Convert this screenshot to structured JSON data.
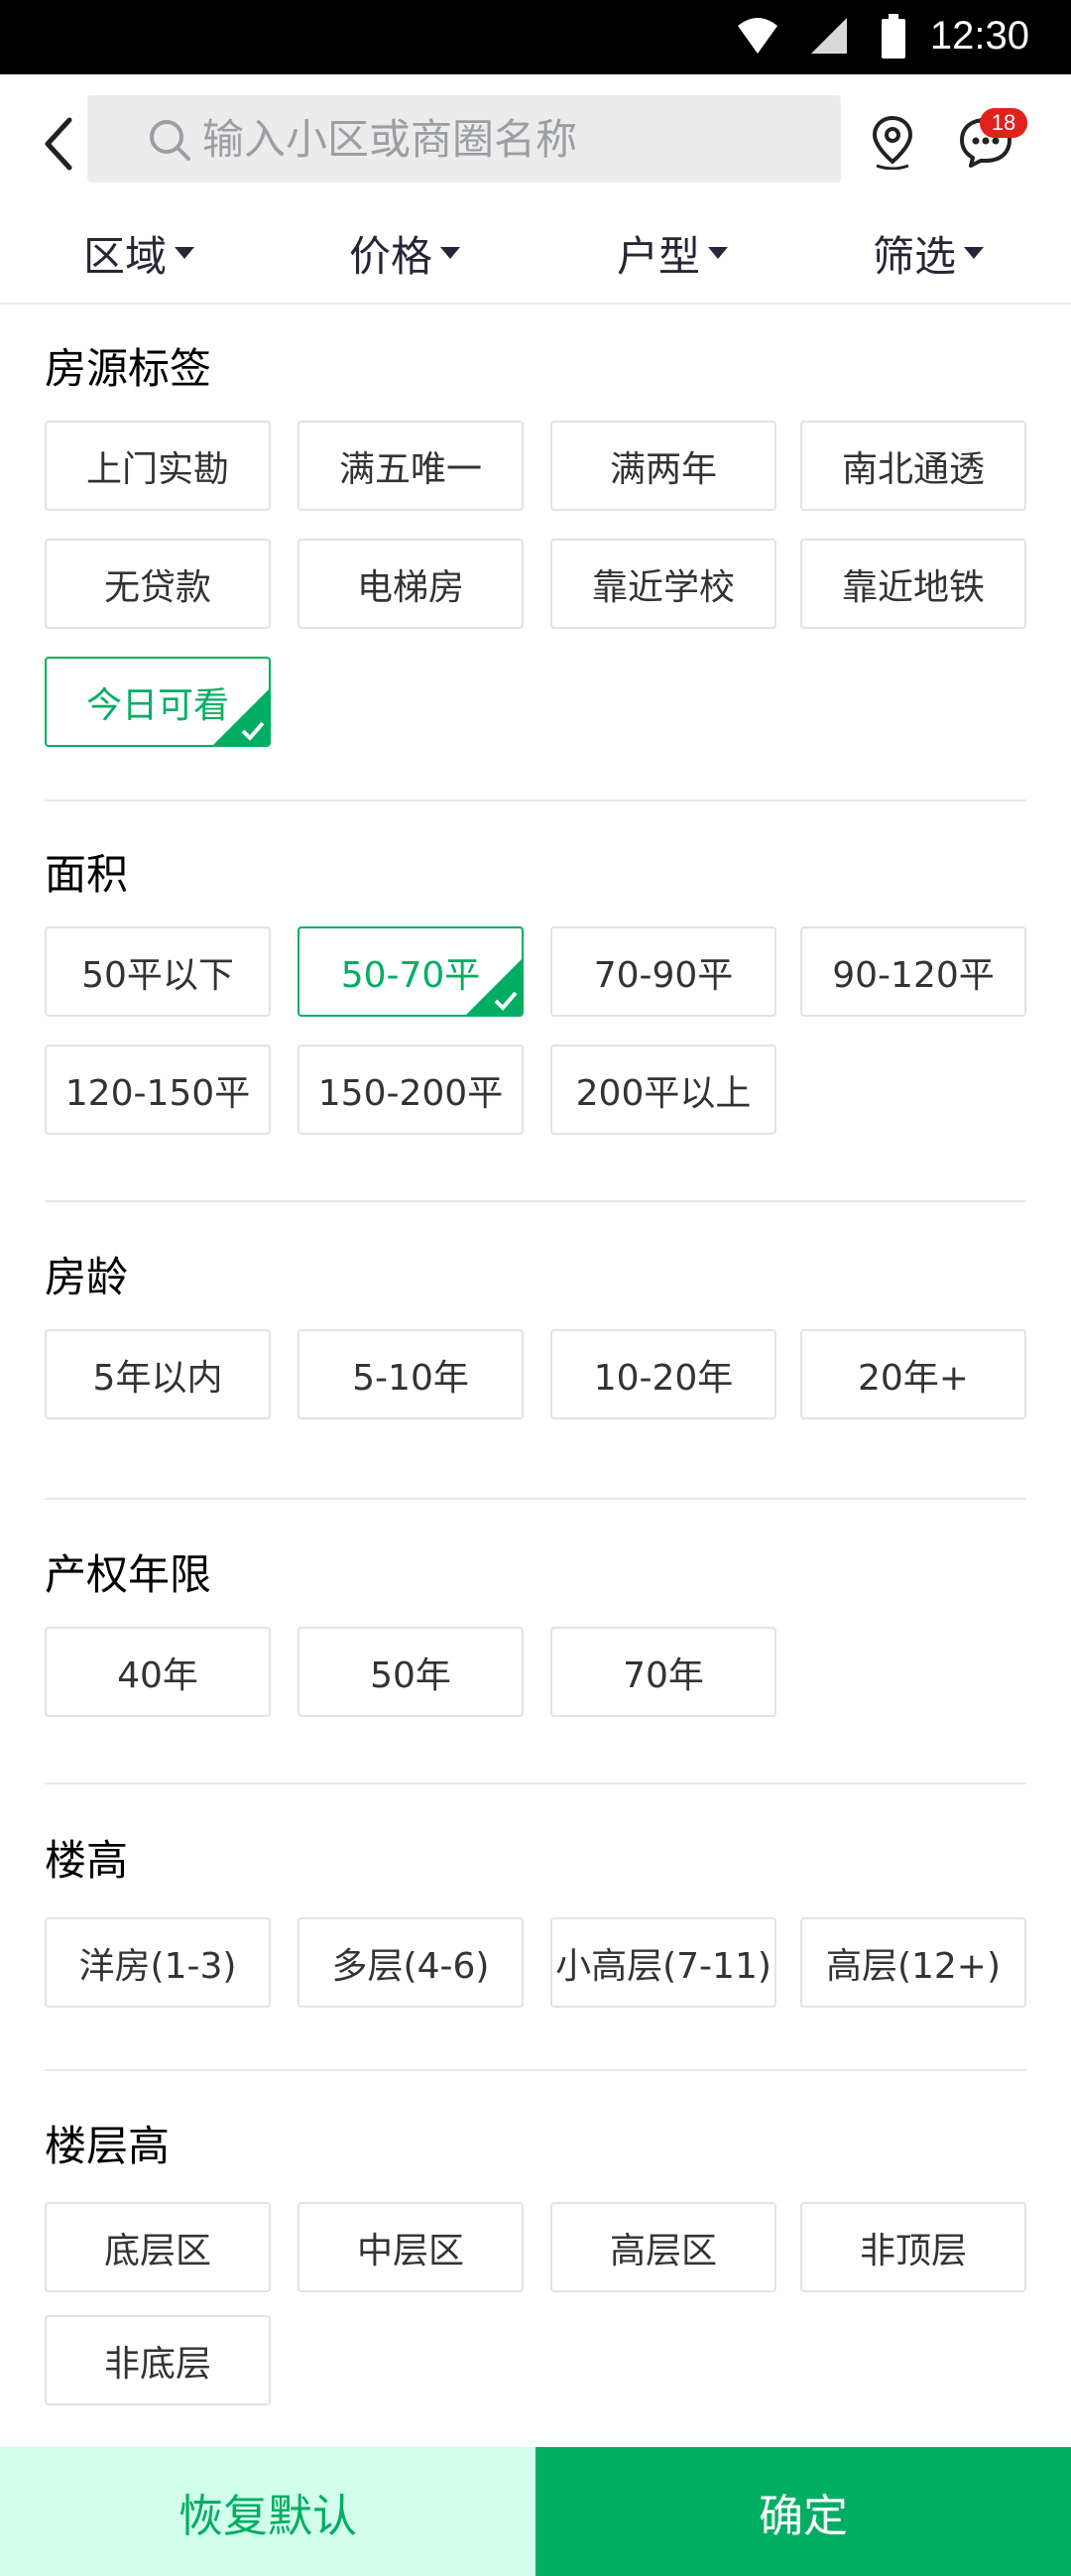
{
  "status_bar": {
    "time": "12:30"
  },
  "header": {
    "search_placeholder": "输入小区或商圈名称",
    "message_badge": "18"
  },
  "filter_tabs": [
    {
      "label": "区域"
    },
    {
      "label": "价格"
    },
    {
      "label": "户型"
    },
    {
      "label": "筛选"
    }
  ],
  "sections": {
    "tags": {
      "title": "房源标签",
      "options": [
        "上门实勘",
        "满五唯一",
        "满两年",
        "南北通透",
        "无贷款",
        "电梯房",
        "靠近学校",
        "靠近地铁",
        "今日可看"
      ],
      "selected": "今日可看"
    },
    "area": {
      "title": "面积",
      "options": [
        "50平以下",
        "50-70平",
        "70-90平",
        "90-120平",
        "120-150平",
        "150-200平",
        "200平以上"
      ],
      "selected": "50-70平"
    },
    "age": {
      "title": "房龄",
      "options": [
        "5年以内",
        "5-10年",
        "10-20年",
        "20年+"
      ]
    },
    "property_term": {
      "title": "产权年限",
      "options": [
        "40年",
        "50年",
        "70年"
      ]
    },
    "building_height": {
      "title": "楼高",
      "options": [
        "洋房(1-3)",
        "多层(4-6)",
        "小高层(7-11)",
        "高层(12+)"
      ]
    },
    "floor_level": {
      "title": "楼层高",
      "options": [
        "底层区",
        "中层区",
        "高层区",
        "非顶层",
        "非底层"
      ]
    }
  },
  "bottom": {
    "reset_label": "恢复默认",
    "confirm_label": "确定"
  },
  "colors": {
    "accent": "#00AE63",
    "accent_light": "#D1FFEB",
    "placeholder": "#9C9EA5",
    "tab_text": "#272536",
    "badge": "#e0211c"
  },
  "icons": {
    "back": "chevron-left-icon",
    "search": "search-icon",
    "map": "location-pin-icon",
    "message": "chat-bubble-icon",
    "check": "check-corner-icon"
  }
}
